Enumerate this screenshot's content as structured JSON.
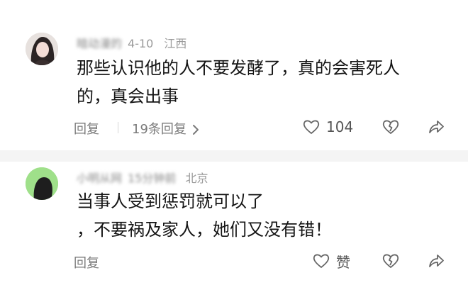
{
  "comments": [
    {
      "meta_blurred": "暗动漫的",
      "meta_date": "4-10",
      "location": "江西",
      "lines": [
        "那些认识他的人不要发酵了，真的会害死人",
        "的，真会出事"
      ],
      "reply_label": "回复",
      "replies_label": "19条回复",
      "like_count": "104"
    },
    {
      "meta_blurred": "小明从网",
      "meta_date": "15分钟前",
      "location": "北京",
      "lines": [
        "当事人受到惩罚就可以了",
        "，不要祸及家人，她们又没有错！"
      ],
      "reply_label": "回复",
      "like_label": "赞"
    }
  ],
  "icons": {
    "like": "heart-outline-icon",
    "dislike": "broken-heart-icon",
    "share": "share-arrow-icon",
    "chevron": "chevron-right-icon"
  },
  "colors": {
    "text": "#141414",
    "meta": "#9a9a9a",
    "action": "#7a7a7a",
    "divider": "#f4f4f4"
  }
}
